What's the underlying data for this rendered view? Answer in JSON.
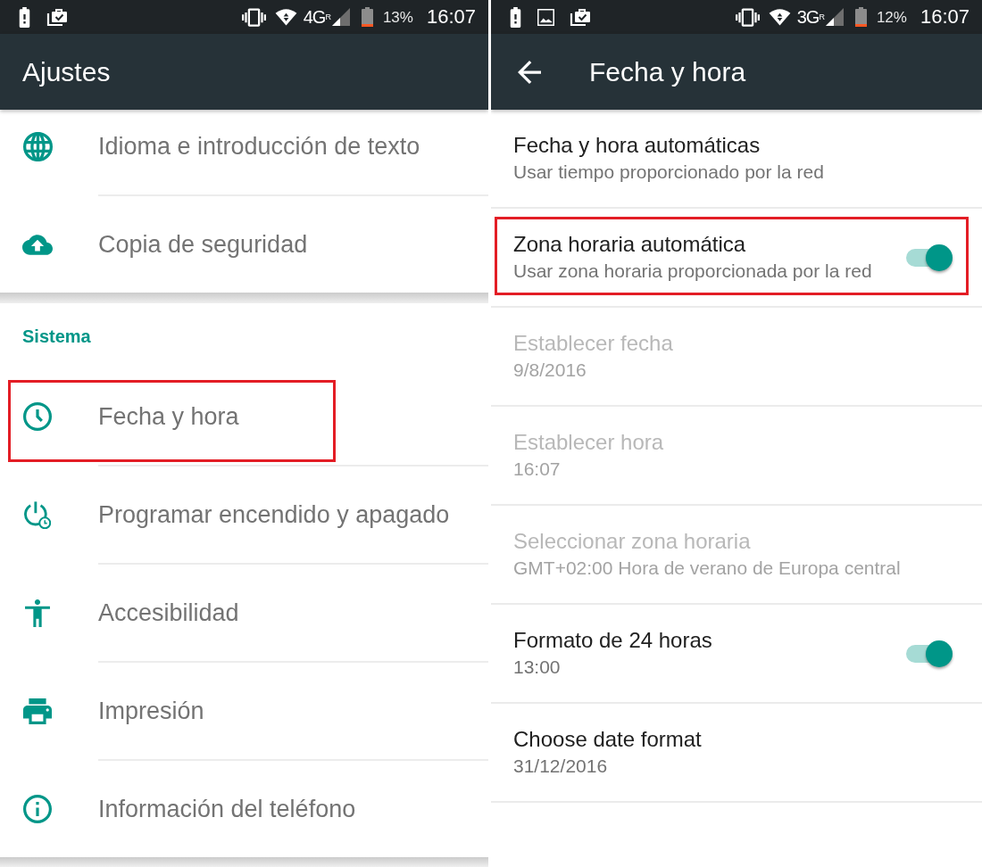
{
  "settings": {
    "status_bar": {
      "notification_icons": [
        {
          "kind": "battery-alert"
        },
        {
          "kind": "briefcase-check"
        }
      ],
      "network": "4G",
      "roaming": "R",
      "battery": "13%",
      "time": "16:07"
    },
    "app_bar": {
      "title": "Ajustes",
      "back": false
    },
    "sections": [
      {
        "items": [
          {
            "kind": "globe",
            "label": "Idioma e introducción de texto",
            "highlighted": false
          },
          {
            "kind": "cloud-upload",
            "label": "Copia de seguridad",
            "highlighted": false
          }
        ]
      },
      {
        "header": "Sistema",
        "items": [
          {
            "kind": "clock",
            "label": "Fecha y hora",
            "highlighted": true
          },
          {
            "kind": "power-clock",
            "label": "Programar encendido y apagado",
            "highlighted": false
          },
          {
            "kind": "person",
            "label": "Accesibilidad",
            "highlighted": false
          },
          {
            "kind": "printer",
            "label": "Impresión",
            "highlighted": false
          },
          {
            "kind": "info",
            "label": "Información del teléfono",
            "highlighted": false
          }
        ]
      }
    ]
  },
  "date_time": {
    "status_bar": {
      "notification_icons": [
        {
          "kind": "battery-alert"
        },
        {
          "kind": "image"
        },
        {
          "kind": "briefcase-check"
        }
      ],
      "network": "3G",
      "roaming": "R",
      "battery": "12%",
      "time": "16:07"
    },
    "app_bar": {
      "title": "Fecha y hora",
      "back": true
    },
    "preferences": [
      {
        "kind": "plain",
        "title": "Fecha y hora automáticas",
        "summary": "Usar tiempo proporcionado por la red",
        "disabled": false,
        "highlighted": false
      },
      {
        "kind": "switch",
        "title": "Zona horaria automática",
        "summary": "Usar zona horaria proporcionada por la red",
        "checked": true,
        "disabled": false,
        "highlighted": true
      },
      {
        "kind": "plain",
        "title": "Establecer fecha",
        "summary": "9/8/2016",
        "disabled": true,
        "highlighted": false
      },
      {
        "kind": "plain",
        "title": "Establecer hora",
        "summary": "16:07",
        "disabled": true,
        "highlighted": false
      },
      {
        "kind": "plain",
        "title": "Seleccionar zona horaria",
        "summary": "GMT+02:00 Hora de verano de Europa central",
        "disabled": true,
        "highlighted": false
      },
      {
        "kind": "switch",
        "title": "Formato de 24 horas",
        "summary": "13:00",
        "checked": true,
        "disabled": false,
        "highlighted": false
      },
      {
        "kind": "plain",
        "title": "Choose date format",
        "summary": "31/12/2016",
        "disabled": false,
        "highlighted": false
      }
    ]
  }
}
